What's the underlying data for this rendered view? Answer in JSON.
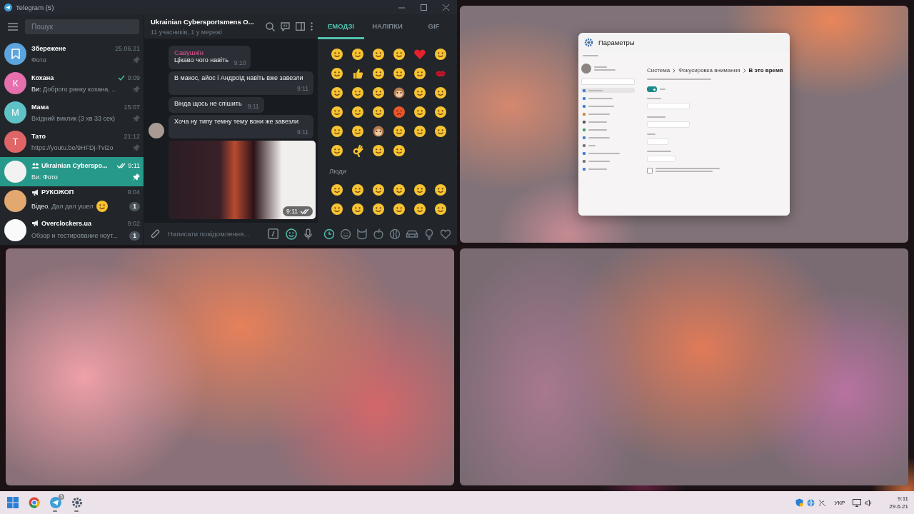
{
  "telegram": {
    "title": "Telegram (5)",
    "search": {
      "placeholder": "Пошук"
    },
    "chats": [
      {
        "name": "Збережене",
        "time": "25.06.21",
        "preview": "Фото",
        "pinned": true,
        "selected": false,
        "kind": "private",
        "sent": false,
        "emoji": false,
        "avatar": {
          "kind": "saved",
          "color": "#5ba4de"
        }
      },
      {
        "name": "Кохана",
        "time": "9:09",
        "sender": "Ви:",
        "preview": "Доброго ранку кохана, ...",
        "pinned": true,
        "selected": false,
        "kind": "private",
        "sent": true,
        "read": false,
        "emoji": false,
        "avatar": {
          "kind": "letter",
          "letter": "К",
          "color": "#e66fae"
        }
      },
      {
        "name": "Мама",
        "time": "15:07",
        "preview": "Вхідний виклик (3 хв 33 сек)",
        "pinned": true,
        "selected": false,
        "kind": "private",
        "sent": false,
        "emoji": false,
        "avatar": {
          "kind": "letter",
          "letter": "М",
          "color": "#5fc2c6"
        }
      },
      {
        "name": "Тато",
        "time": "21:12",
        "preview": "https://youtu.be/9HFDj-Tvi2o",
        "pinned": true,
        "selected": false,
        "kind": "private",
        "sent": false,
        "emoji": false,
        "avatar": {
          "kind": "letter",
          "letter": "Т",
          "color": "#e06567"
        }
      },
      {
        "name": "Ukrainian Cyberspo...",
        "time": "9:11",
        "sender": "Ви:",
        "preview": "Фото",
        "pinned": true,
        "selected": true,
        "kind": "group",
        "sent": true,
        "read": true,
        "emoji": false,
        "avatar": {
          "kind": "image",
          "color": "#f2f2f2"
        }
      },
      {
        "name": "РУКОЖОП",
        "time": "9:04",
        "sender": "Відео.",
        "preview": "Дал дал ушел",
        "emoji": true,
        "unread": "1",
        "pinned": false,
        "selected": false,
        "kind": "channel",
        "sent": false,
        "avatar": {
          "kind": "image",
          "color": "#e2a86f"
        }
      },
      {
        "name": "Overclockers.ua",
        "time": "9:02",
        "preview": "Обзор и тестирование ноут...",
        "unread": "1",
        "pinned": false,
        "selected": false,
        "kind": "channel",
        "sent": false,
        "emoji": false,
        "avatar": {
          "kind": "image",
          "color": "#fafafa"
        }
      }
    ],
    "chat": {
      "title": "Ukrainian Cybersportsmens O...",
      "subtitle": "11 учасників, 1 у мережі",
      "messages": [
        {
          "kind": "text",
          "author": "Савушкін",
          "text": "Цікаво чого навіть",
          "time": "9:10",
          "avatar": false
        },
        {
          "kind": "text",
          "text": "В макос, айос і Андроїд навіть вже завезли",
          "time": "9:11",
          "avatar": false
        },
        {
          "kind": "text",
          "text": "Вінда щось не спішить",
          "time": "9:11",
          "avatar": false
        },
        {
          "kind": "text",
          "text": "Хоча ну типу темну тему вони же завезли",
          "time": "9:11",
          "avatar": true
        },
        {
          "kind": "photo",
          "time": "9:11",
          "read": true,
          "avatar": false
        }
      ],
      "input": {
        "placeholder": "Написати повідомлення..."
      }
    },
    "emoji": {
      "tabs": [
        {
          "label": "ЕМОДЗІ",
          "selected": true
        },
        {
          "label": "НАЛІПКИ",
          "selected": false
        },
        {
          "label": "GIF",
          "selected": false
        }
      ],
      "section": "Люди",
      "categories": [
        {
          "kind": "recent",
          "selected": true
        },
        {
          "kind": "smile",
          "selected": false
        },
        {
          "kind": "cat",
          "selected": false
        },
        {
          "kind": "apple",
          "selected": false
        },
        {
          "kind": "ball",
          "selected": false
        },
        {
          "kind": "car",
          "selected": false
        },
        {
          "kind": "bulb",
          "selected": false
        },
        {
          "kind": "heart",
          "selected": false
        }
      ]
    }
  },
  "settings": {
    "title": "Параметры",
    "breadcrumb": [
      "Система",
      "Фокусировка внимания",
      "В это время"
    ],
    "toggle_on": true,
    "checkbox_checked": false,
    "sidebar_items": [
      {
        "selected": true
      },
      {
        "selected": false
      },
      {
        "selected": false
      },
      {
        "selected": false
      },
      {
        "selected": false
      },
      {
        "selected": false
      },
      {
        "selected": false
      },
      {
        "selected": false
      },
      {
        "selected": false
      },
      {
        "selected": false
      },
      {
        "selected": false
      }
    ]
  },
  "taskbar": {
    "apps": [
      {
        "kind": "start",
        "running": false
      },
      {
        "kind": "browser",
        "running": false
      },
      {
        "kind": "telegram",
        "running": true,
        "badge": "5"
      },
      {
        "kind": "settings",
        "running": true
      }
    ],
    "language": "УКР",
    "time": "9:11",
    "date": "29.6.21"
  }
}
